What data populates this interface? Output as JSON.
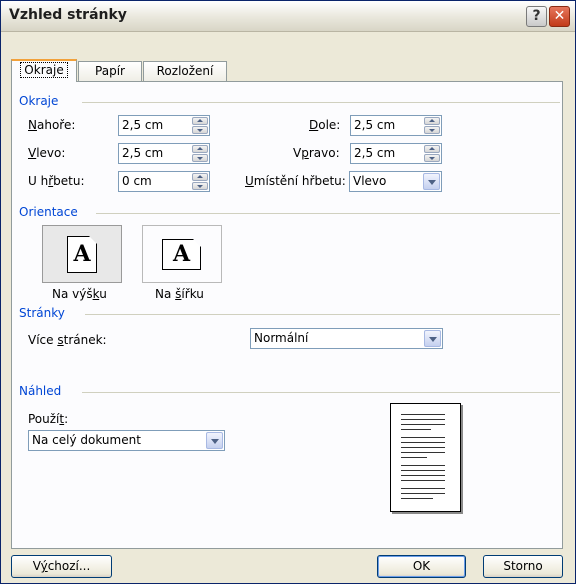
{
  "window": {
    "title": "Vzhled stránky",
    "help_icon": "question-mark-icon",
    "close_icon": "close-x-icon",
    "help_glyph": "?",
    "close_glyph": "✕"
  },
  "tabs": [
    {
      "label": "Okraje",
      "active": true
    },
    {
      "label": "Papír",
      "active": false
    },
    {
      "label": "Rozložení",
      "active": false
    }
  ],
  "margins": {
    "group_title": "Okraje",
    "top": {
      "label_u": "N",
      "label_rest": "ahoře:",
      "value": "2,5 cm"
    },
    "left": {
      "label_u": "V",
      "label_rest": "levo:",
      "value": "2,5 cm"
    },
    "gutter": {
      "label_pre": "U h",
      "label_u": "ř",
      "label_rest": "betu:",
      "value": "0 cm"
    },
    "bottom": {
      "label_u": "D",
      "label_rest": "ole:",
      "value": "2,5 cm"
    },
    "right": {
      "label_pre": "V",
      "label_u": "p",
      "label_rest": "ravo:",
      "value": "2,5 cm"
    },
    "gutter_position": {
      "label_u": "U",
      "label_rest": "místění hřbetu:",
      "value": "Vlevo"
    }
  },
  "orientation": {
    "group_title": "Orientace",
    "glyph": "A",
    "portrait": {
      "label_pre": "Na výš",
      "label_u": "k",
      "label_rest": "u",
      "selected": true
    },
    "landscape": {
      "label_pre": "Na ",
      "label_u": "š",
      "label_rest": "ířku",
      "selected": false
    }
  },
  "pages": {
    "group_title": "Stránky",
    "multiple_label_pre": "Více ",
    "multiple_label_u": "s",
    "multiple_label_rest": "tránek:",
    "multiple_value": "Normální"
  },
  "preview": {
    "group_title": "Náhled",
    "apply_label_pre": "Použí",
    "apply_label_u": "t",
    "apply_label_rest": ":",
    "apply_value": "Na celý dokument"
  },
  "buttons": {
    "default_pre": "V",
    "default_u": "ý",
    "default_rest": "chozí...",
    "ok": "OK",
    "cancel": "Storno"
  }
}
